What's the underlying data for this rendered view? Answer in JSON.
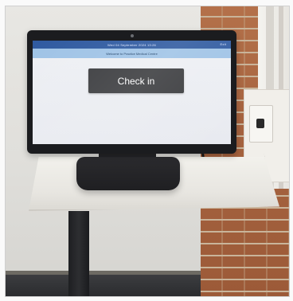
{
  "screen": {
    "top_bar_text": "Wed 04 September 2024 13:26",
    "top_bar_right": "Exit",
    "info_bar_text": "Welcome to Practice Medical Centre",
    "checkin_label": "Check in"
  },
  "colors": {
    "screen_topbar": "#2f5aa0",
    "screen_infobar": "#9fc3e6",
    "checkin_button": "#3b3c3f"
  }
}
